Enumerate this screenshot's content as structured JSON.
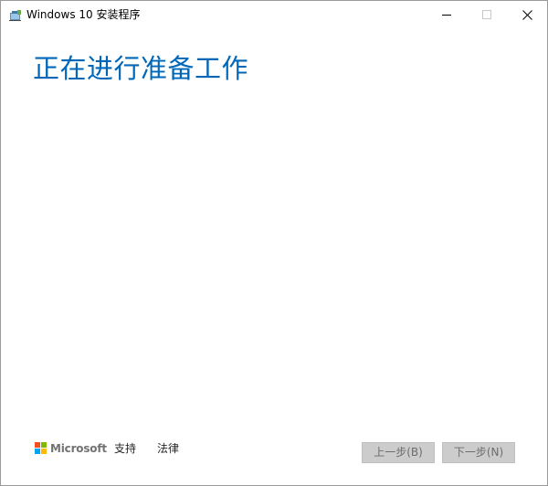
{
  "window": {
    "title": "Windows 10 安装程序",
    "app_icon": "setup-icon",
    "controls": {
      "minimize_icon": "minimize-icon",
      "maximize_icon": "maximize-icon",
      "close_icon": "close-icon"
    }
  },
  "main": {
    "heading": "正在进行准备工作"
  },
  "footer": {
    "brand": "Microsoft",
    "brand_icon": "microsoft-logo-icon",
    "links": {
      "support": "支持",
      "legal": "法律"
    },
    "buttons": {
      "back": "上一步(B)",
      "next": "下一步(N)"
    }
  },
  "colors": {
    "heading": "#0067b8",
    "button_disabled_bg": "#cccccc",
    "button_disabled_text": "#6d6d6d",
    "logo_red": "#f25022",
    "logo_green": "#7fba00",
    "logo_blue": "#00a4ef",
    "logo_yellow": "#ffb900"
  }
}
